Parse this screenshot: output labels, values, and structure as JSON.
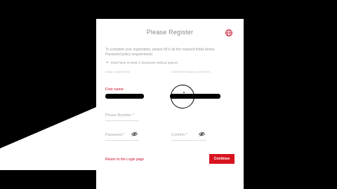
{
  "dialog": {
    "title": "Please Register",
    "intro_line1": "To complete your registration, please fill in all the required fields below.",
    "intro_line2": "Password policy requirements:",
    "policy_rule": "Must have at least 4 characters without spaces"
  },
  "fields": {
    "email_label": "EMAIL ADDRESS",
    "confirm_email_label": "CONFIRM EMAIL ADDRESS",
    "first_name_label": "First name",
    "phone_label": "Phone Number *",
    "password_label": "Password *",
    "confirm_password_label": "Confirm *"
  },
  "actions": {
    "return_link": "Return to the Login page",
    "continue_label": "Continue"
  },
  "colors": {
    "accent": "#d7141e",
    "background": "#000000",
    "card": "#ffffff"
  },
  "icons": {
    "language": "globe-icon",
    "show_password": "eye-slash-icon"
  }
}
